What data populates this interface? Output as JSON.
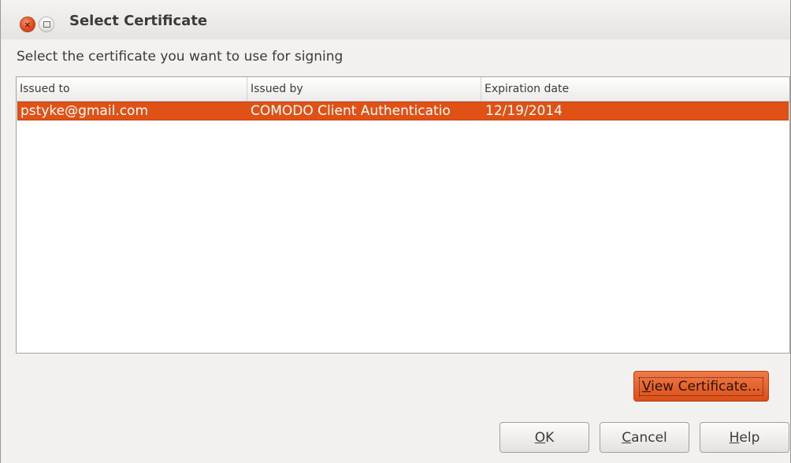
{
  "window": {
    "title": "Select Certificate"
  },
  "prompt": "Select the certificate you want to use for signing",
  "table": {
    "columns": [
      "Issued to",
      "Issued by",
      "Expiration date"
    ],
    "rows": [
      {
        "issued_to": "pstyke@gmail.com",
        "issued_by": "COMODO Client Authenticatio",
        "expiration": "12/19/2014",
        "selected": true
      }
    ]
  },
  "buttons": {
    "view_certificate": {
      "mnemonic": "V",
      "rest": "iew Certificate..."
    },
    "ok": {
      "mnemonic": "O",
      "rest": "K"
    },
    "cancel": {
      "mnemonic": "C",
      "rest": "ancel"
    },
    "help": {
      "mnemonic": "H",
      "rest": "elp"
    }
  },
  "colors": {
    "accent": "#e05116",
    "window_bg": "#f2f1f0"
  },
  "icons": {
    "close": "close-icon",
    "maximize": "maximize-icon"
  }
}
